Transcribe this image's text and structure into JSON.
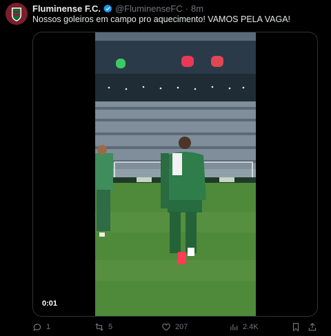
{
  "tweet": {
    "author_name": "Fluminense F.C.",
    "handle": "@FluminenseFC",
    "separator": "·",
    "time_ago": "8m",
    "text": "Nossos goleiros em campo pro aquecimento! VAMOS PELA VAGA!"
  },
  "media": {
    "timestamp": "0:01"
  },
  "actions": {
    "replies": "1",
    "reposts": "5",
    "likes": "207",
    "views": "2.4K"
  },
  "colors": {
    "background": "#000000",
    "text_primary": "#e7e9ea",
    "text_secondary": "#71767b",
    "verified": "#1d9bf0",
    "border": "#2f3336",
    "brand": "#7a1f2b"
  },
  "icons": [
    "fluminense-crest-icon",
    "verified-badge-icon",
    "reply-icon",
    "repost-icon",
    "like-icon",
    "views-icon",
    "bookmark-icon",
    "share-icon"
  ]
}
